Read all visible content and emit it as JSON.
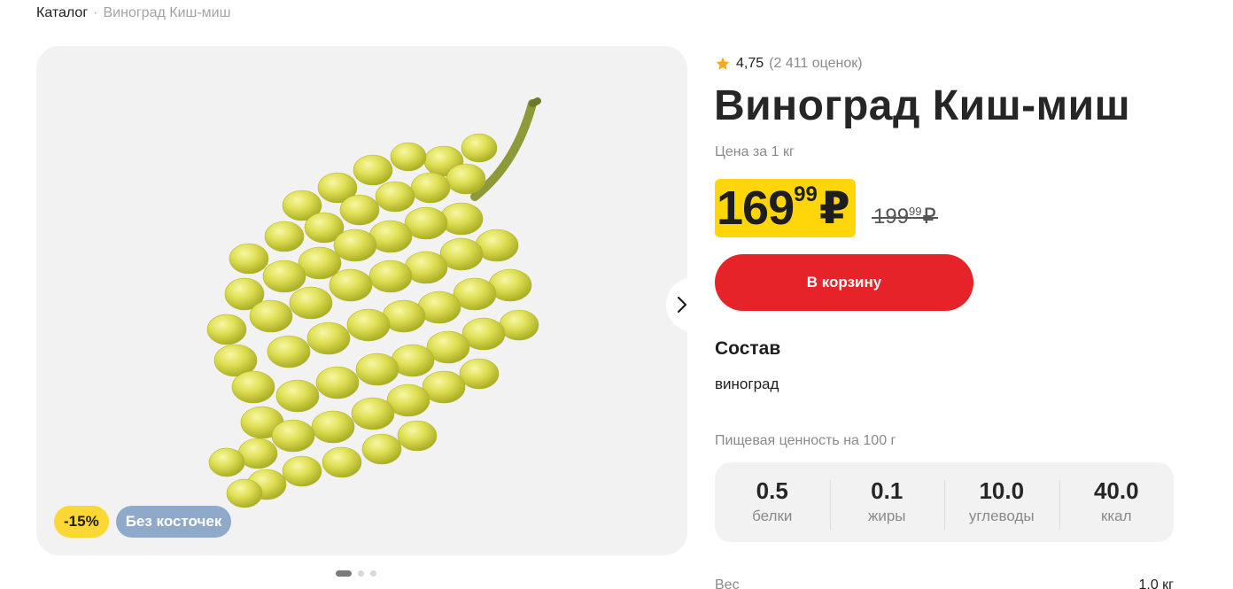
{
  "breadcrumb": {
    "catalog": "Каталог",
    "separator": "·",
    "current": "Виноград Киш-миш"
  },
  "product": {
    "rating": "4,75",
    "ratings_count": "(2 411 оценок)",
    "title": "Виноград Киш-миш",
    "price_caption": "Цена за 1 кг",
    "price": {
      "rub": "169",
      "kop": "99",
      "currency": "₽"
    },
    "old_price": {
      "rub": "199",
      "kop": "99",
      "currency": "₽"
    },
    "badges": {
      "discount": "-15%",
      "seedless": "Без косточек"
    },
    "cart_button": "В корзину"
  },
  "composition": {
    "title": "Состав",
    "text": "виноград"
  },
  "nutrition": {
    "caption": "Пищевая ценность на 100 г",
    "items": [
      {
        "value": "0.5",
        "label": "белки"
      },
      {
        "value": "0.1",
        "label": "жиры"
      },
      {
        "value": "10.0",
        "label": "углеводы"
      },
      {
        "value": "40.0",
        "label": "ккал"
      }
    ]
  },
  "weight": {
    "label": "Вес",
    "value": "1.0 кг"
  },
  "colors": {
    "accent_red": "#e52328",
    "price_yellow": "#ffd60a",
    "badge_blue": "#8ea9ca",
    "star": "#f5a623"
  },
  "icons": {
    "rating": "star-icon",
    "next": "chevron-right-icon"
  },
  "gallery": {
    "slides": 3,
    "active_slide": 1
  }
}
